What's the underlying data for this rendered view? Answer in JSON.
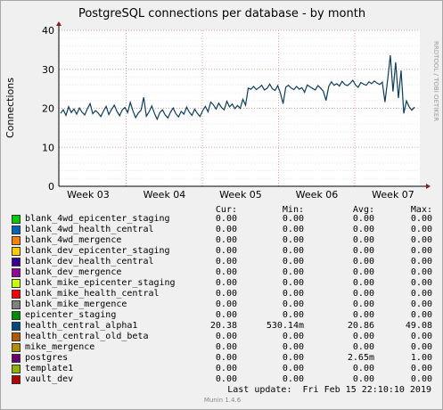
{
  "chart_data": {
    "type": "line",
    "title": "PostgreSQL connections per database - by month",
    "ylabel": "Connections",
    "xlabel": "",
    "side_label": "RRDTOOL / TOBI OETIKER",
    "ylim": [
      0,
      40
    ],
    "yticks": [
      "0",
      "10",
      "20",
      "30",
      "40"
    ],
    "xticks": [
      "Week 03",
      "Week 04",
      "Week 05",
      "Week 06",
      "Week 07"
    ],
    "grid": true,
    "series": [
      {
        "name": "health_central_alpha1",
        "color": "#0b3d5f",
        "values": [
          18.7,
          19.6,
          18.2,
          20.4,
          18.9,
          19.8,
          18.5,
          20.1,
          19.0,
          18.3,
          19.9,
          21.2,
          18.6,
          19.4,
          18.8,
          17.9,
          19.3,
          20.5,
          18.4,
          19.7,
          20.8,
          19.2,
          18.1,
          19.6,
          20.2,
          18.9,
          21.5,
          19.3,
          17.6,
          18.8,
          19.5,
          22.8,
          18.0,
          19.1,
          20.6,
          18.7,
          17.2,
          18.9,
          19.6,
          18.3,
          17.5,
          19.0,
          20.1,
          18.6,
          17.8,
          19.2,
          18.5,
          20.3,
          19.0,
          18.2,
          19.8,
          18.7,
          17.9,
          19.4,
          20.5,
          19.1,
          21.6,
          20.9,
          19.8,
          21.3,
          20.2,
          19.6,
          21.8,
          20.4,
          21.1,
          19.9,
          20.7,
          20.0,
          22.3,
          20.8,
          25.2,
          24.9,
          25.6,
          24.8,
          25.3,
          25.9,
          24.7,
          25.1,
          26.2,
          25.0,
          24.6,
          25.8,
          23.9,
          21.2,
          25.4,
          25.9,
          25.2,
          24.8,
          25.6,
          24.9,
          25.3,
          24.1,
          26.0,
          25.5,
          25.1,
          24.7,
          25.8,
          25.2,
          24.4,
          22.0,
          25.6,
          26.8,
          25.9,
          26.3,
          25.7,
          26.9,
          26.1,
          25.8,
          26.4,
          27.2,
          26.0,
          25.4,
          26.6,
          26.2,
          25.9,
          26.8,
          26.3,
          27.0,
          26.5,
          26.1,
          26.7,
          21.6,
          27.3,
          33.6,
          24.3,
          31.8,
          22.6,
          29.7,
          18.7,
          21.9,
          20.4,
          19.5,
          20.3
        ]
      }
    ],
    "legend": {
      "headers": [
        "Cur:",
        "Min:",
        "Avg:",
        "Max:"
      ],
      "rows": [
        {
          "name": "blank_4wd_epicenter_staging",
          "color": "#00cc00",
          "cur": "0.00",
          "min": "0.00",
          "avg": "0.00",
          "max": "0.00"
        },
        {
          "name": "blank_4wd_health_central",
          "color": "#0066b3",
          "cur": "0.00",
          "min": "0.00",
          "avg": "0.00",
          "max": "0.00"
        },
        {
          "name": "blank_4wd_mergence",
          "color": "#ff8000",
          "cur": "0.00",
          "min": "0.00",
          "avg": "0.00",
          "max": "0.00"
        },
        {
          "name": "blank_dev_epicenter_staging",
          "color": "#ffcc00",
          "cur": "0.00",
          "min": "0.00",
          "avg": "0.00",
          "max": "0.00"
        },
        {
          "name": "blank_dev_health_central",
          "color": "#330099",
          "cur": "0.00",
          "min": "0.00",
          "avg": "0.00",
          "max": "0.00"
        },
        {
          "name": "blank_dev_mergence",
          "color": "#990099",
          "cur": "0.00",
          "min": "0.00",
          "avg": "0.00",
          "max": "0.00"
        },
        {
          "name": "blank_mike_epicenter_staging",
          "color": "#ccff00",
          "cur": "0.00",
          "min": "0.00",
          "avg": "0.00",
          "max": "0.00"
        },
        {
          "name": "blank_mike_health_central",
          "color": "#ff0000",
          "cur": "0.00",
          "min": "0.00",
          "avg": "0.00",
          "max": "0.00"
        },
        {
          "name": "blank_mike_mergence",
          "color": "#808080",
          "cur": "0.00",
          "min": "0.00",
          "avg": "0.00",
          "max": "0.00"
        },
        {
          "name": "epicenter_staging",
          "color": "#008f00",
          "cur": "0.00",
          "min": "0.00",
          "avg": "0.00",
          "max": "0.00"
        },
        {
          "name": "health_central_alpha1",
          "color": "#00487d",
          "cur": "20.38",
          "min": "530.14m",
          "avg": "20.86",
          "max": "49.08"
        },
        {
          "name": "health_central_old_beta",
          "color": "#b35a00",
          "cur": "0.00",
          "min": "0.00",
          "avg": "0.00",
          "max": "0.00"
        },
        {
          "name": "mike_mergence",
          "color": "#b38f00",
          "cur": "0.00",
          "min": "0.00",
          "avg": "0.00",
          "max": "0.00"
        },
        {
          "name": "postgres",
          "color": "#6b006b",
          "cur": "0.00",
          "min": "0.00",
          "avg": "2.65m",
          "max": "1.00"
        },
        {
          "name": "template1",
          "color": "#8fb300",
          "cur": "0.00",
          "min": "0.00",
          "avg": "0.00",
          "max": "0.00"
        },
        {
          "name": "vault_dev",
          "color": "#b30000",
          "cur": "0.00",
          "min": "0.00",
          "avg": "0.00",
          "max": "0.00"
        }
      ]
    }
  },
  "footer": {
    "last_update": "Last update:  Fri Feb 15 22:10:10 2019",
    "version": "Munin 1.4.6"
  }
}
